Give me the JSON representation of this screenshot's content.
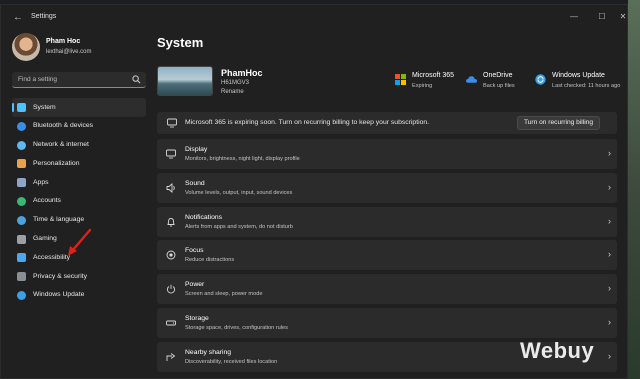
{
  "window": {
    "title": "Settings"
  },
  "profile": {
    "name": "Pham Hoc",
    "email": "lexthai@live.com"
  },
  "search": {
    "placeholder": "Find a setting"
  },
  "sidebar": {
    "items": [
      {
        "label": "System",
        "icon": "monitor-icon",
        "color": "#4cc2ff",
        "active": true
      },
      {
        "label": "Bluetooth & devices",
        "icon": "bluetooth-icon",
        "color": "#3a8ee6"
      },
      {
        "label": "Network & internet",
        "icon": "wifi-icon",
        "color": "#5db7f0"
      },
      {
        "label": "Personalization",
        "icon": "brush-icon",
        "color": "#e8a24a"
      },
      {
        "label": "Apps",
        "icon": "apps-icon",
        "color": "#8ea4c8"
      },
      {
        "label": "Accounts",
        "icon": "person-icon",
        "color": "#39b878"
      },
      {
        "label": "Time & language",
        "icon": "globe-icon",
        "color": "#4aa3df"
      },
      {
        "label": "Gaming",
        "icon": "gamepad-icon",
        "color": "#9aa0a6"
      },
      {
        "label": "Accessibility",
        "icon": "accessibility-icon",
        "color": "#4aa8f0"
      },
      {
        "label": "Privacy & security",
        "icon": "shield-icon",
        "color": "#8a8f96"
      },
      {
        "label": "Windows Update",
        "icon": "update-icon",
        "color": "#3aa0e8"
      }
    ]
  },
  "main": {
    "title": "System",
    "device": {
      "name": "PhamHoc",
      "model": "H61MGV3",
      "rename": "Rename"
    },
    "quick_info": [
      {
        "title": "Microsoft 365",
        "sub": "Expiring",
        "icon": "microsoft-logo-icon"
      },
      {
        "title": "OneDrive",
        "sub": "Back up files",
        "icon": "cloud-icon"
      },
      {
        "title": "Windows Update",
        "sub": "Last checked: 11 hours ago",
        "icon": "update-icon"
      }
    ],
    "banner": {
      "text": "Microsoft 365 is expiring soon. Turn on recurring billing to keep your subscription.",
      "button": "Turn on recurring billing"
    },
    "cards": [
      {
        "title": "Display",
        "sub": "Monitors, brightness, night light, display profile",
        "icon": "display-icon"
      },
      {
        "title": "Sound",
        "sub": "Volume levels, output, input, sound devices",
        "icon": "speaker-icon"
      },
      {
        "title": "Notifications",
        "sub": "Alerts from apps and system, do not disturb",
        "icon": "bell-icon"
      },
      {
        "title": "Focus",
        "sub": "Reduce distractions",
        "icon": "focus-icon"
      },
      {
        "title": "Power",
        "sub": "Screen and sleep, power mode",
        "icon": "power-icon"
      },
      {
        "title": "Storage",
        "sub": "Storage space, drives, configuration rules",
        "icon": "storage-icon"
      },
      {
        "title": "Nearby sharing",
        "sub": "Discoverability, received files location",
        "icon": "share-icon"
      }
    ]
  },
  "watermark": "Webuy"
}
